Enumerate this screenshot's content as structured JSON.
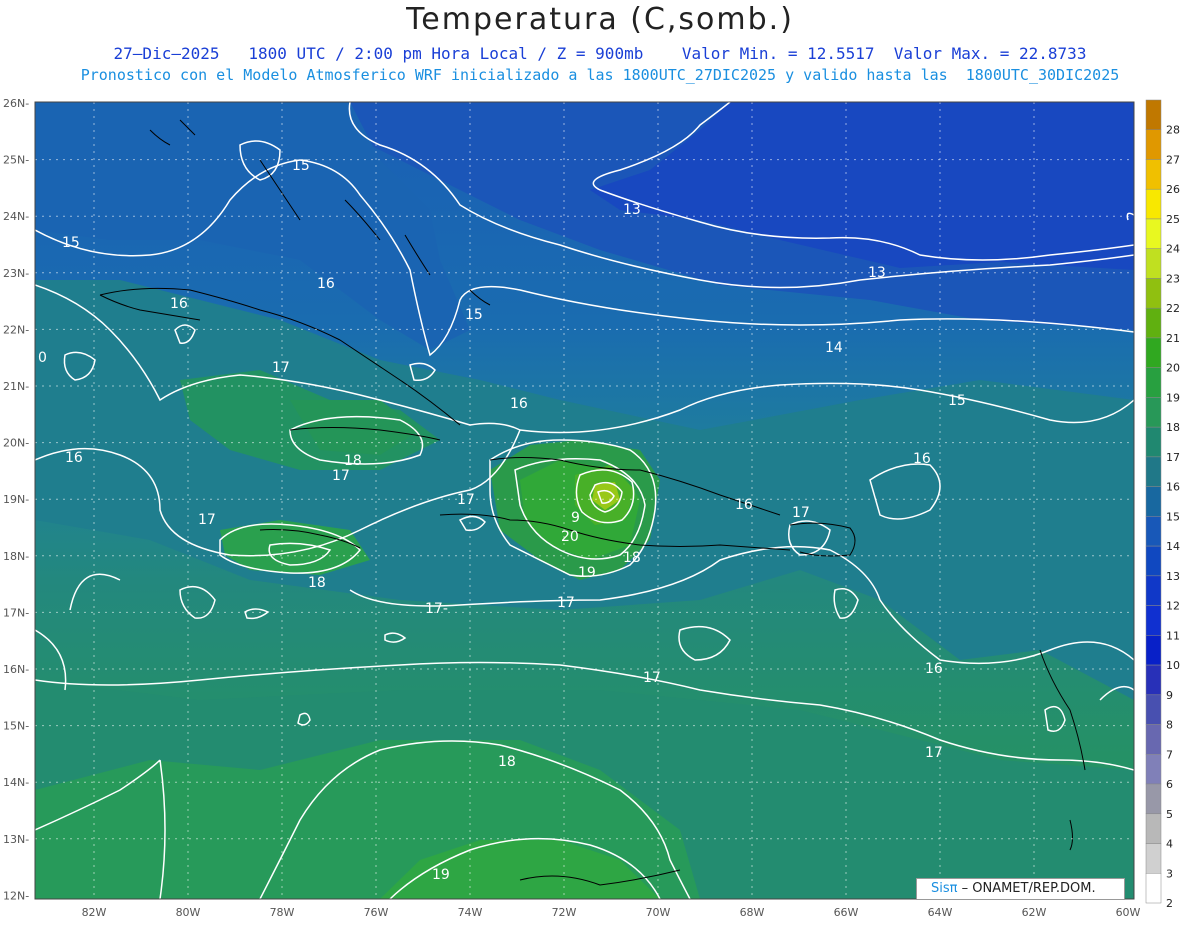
{
  "header": {
    "title": "Temperatura (C,somb.)",
    "line1": "27–Dic–2025   1800 UTC / 2:00 pm Hora Local / Z = 900mb    Valor Min. = 12.5517  Valor Max. = 22.8733",
    "line2": "Pronostico con el Modelo Atmosferico WRF inicializado a las 1800UTC_27DIC2025 y valido hasta las  1800UTC_30DIC2025"
  },
  "axes": {
    "lat_labels": [
      "26N",
      "25N",
      "24N",
      "23N",
      "22N",
      "21N",
      "20N",
      "19N",
      "18N",
      "17N",
      "16N",
      "15N",
      "14N",
      "13N",
      "12N"
    ],
    "lon_labels": [
      "82W",
      "80W",
      "78W",
      "76W",
      "74W",
      "72W",
      "70W",
      "68W",
      "66W",
      "64W",
      "62W",
      "60W"
    ]
  },
  "colorbar": {
    "labels": [
      "28",
      "27",
      "26",
      "25",
      "24",
      "23",
      "22",
      "21",
      "20",
      "19",
      "18",
      "17",
      "16",
      "15",
      "14",
      "13",
      "12",
      "11",
      "10",
      "9",
      "8",
      "7",
      "6",
      "5",
      "4",
      "3",
      "2"
    ],
    "colors": [
      "#c07800",
      "#e09800",
      "#f0c000",
      "#f8e800",
      "#e8f820",
      "#c0e020",
      "#90c010",
      "#60b010",
      "#30a820",
      "#28a040",
      "#289858",
      "#208870",
      "#207888",
      "#1868a0",
      "#1858b8",
      "#1048c0",
      "#1038c8",
      "#1030d0",
      "#0820c8",
      "#2830b8",
      "#4850b0",
      "#6868b0",
      "#8080b8",
      "#9898a8",
      "#b8b8b8",
      "#d0d0d0",
      "#ffffff"
    ]
  },
  "contour_labels": [
    {
      "text": "15",
      "id": "c15a"
    },
    {
      "text": "15",
      "id": "c15b"
    },
    {
      "text": "15",
      "id": "c15c"
    },
    {
      "text": "15",
      "id": "c15d"
    },
    {
      "text": "13",
      "id": "c13a"
    },
    {
      "text": "13",
      "id": "c13b"
    },
    {
      "text": "14",
      "id": "c14a"
    },
    {
      "text": "16",
      "id": "c16a"
    },
    {
      "text": "16",
      "id": "c16b"
    },
    {
      "text": "16",
      "id": "c16c"
    },
    {
      "text": "16",
      "id": "c16d"
    },
    {
      "text": "16",
      "id": "c16e"
    },
    {
      "text": "16",
      "id": "c16f"
    },
    {
      "text": "16",
      "id": "c16g"
    },
    {
      "text": "17",
      "id": "c17a"
    },
    {
      "text": "17",
      "id": "c17b"
    },
    {
      "text": "17",
      "id": "c17c"
    },
    {
      "text": "17",
      "id": "c17d"
    },
    {
      "text": "17",
      "id": "c17e"
    },
    {
      "text": "17-",
      "id": "c17f"
    },
    {
      "text": "17",
      "id": "c17g"
    },
    {
      "text": "17",
      "id": "c17h"
    },
    {
      "text": "17",
      "id": "c17i"
    },
    {
      "text": "18",
      "id": "c18a"
    },
    {
      "text": "18",
      "id": "c18b"
    },
    {
      "text": "18",
      "id": "c18c"
    },
    {
      "text": "18",
      "id": "c18d"
    },
    {
      "text": "19",
      "id": "c19a"
    },
    {
      "text": "19",
      "id": "c19b"
    },
    {
      "text": "20",
      "id": "c20a"
    },
    {
      "text": "9",
      "id": "c9a"
    },
    {
      "text": "0",
      "id": "c0a"
    }
  ],
  "credit": {
    "sis": "Sisπ",
    "rest": " – ONAMET/REP.DOM."
  }
}
